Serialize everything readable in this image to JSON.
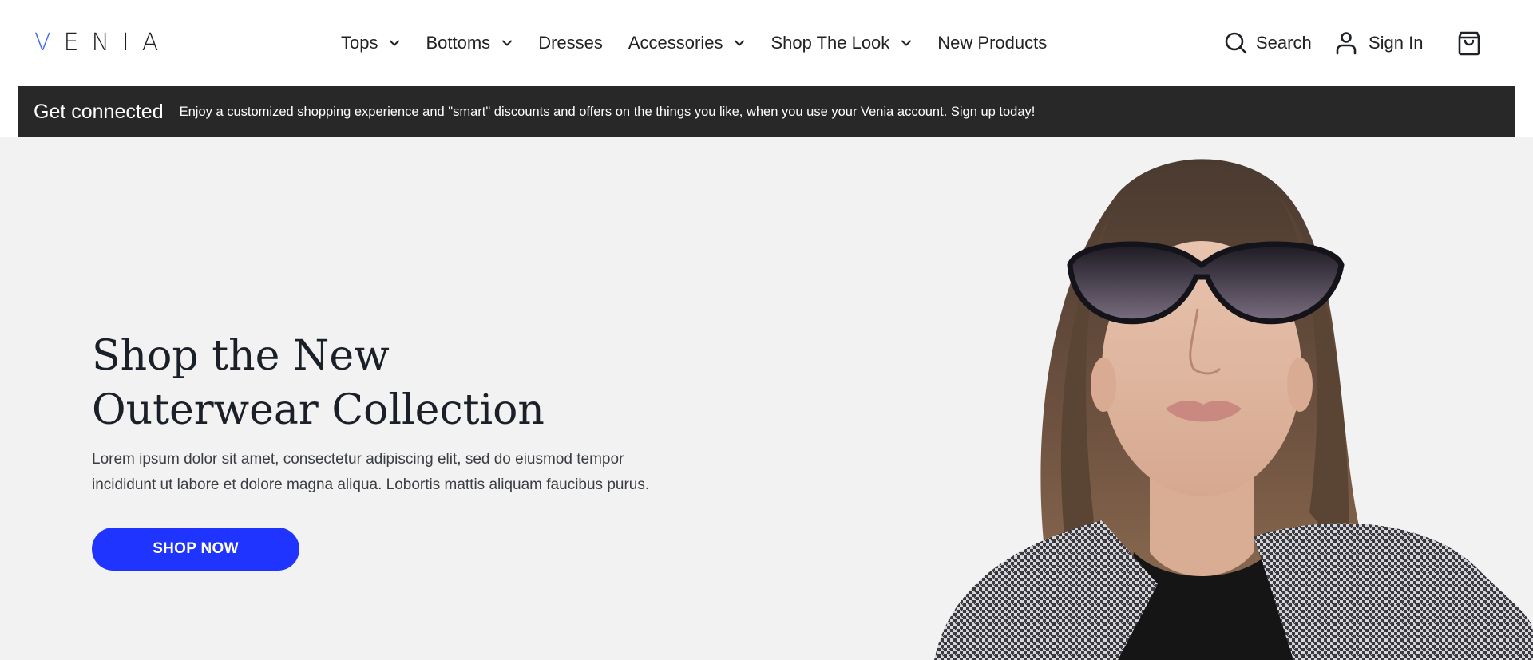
{
  "header": {
    "logo_first": "V",
    "logo_rest": "ENIA",
    "nav": [
      {
        "label": "Tops",
        "has_dropdown": true
      },
      {
        "label": "Bottoms",
        "has_dropdown": true
      },
      {
        "label": "Dresses",
        "has_dropdown": false
      },
      {
        "label": "Accessories",
        "has_dropdown": true
      },
      {
        "label": "Shop The Look",
        "has_dropdown": true
      },
      {
        "label": "New Products",
        "has_dropdown": false
      }
    ],
    "search_label": "Search",
    "signin_label": "Sign In",
    "icons": {
      "search": "search-icon",
      "account": "user-icon",
      "cart": "shopping-bag-icon",
      "dropdown": "chevron-down-icon"
    }
  },
  "banner": {
    "title": "Get connected",
    "text": "Enjoy a customized shopping experience and \"smart\" discounts and offers on the things you like, when you use your Venia account. Sign up today!"
  },
  "hero": {
    "title_line1": "Shop the New",
    "title_line2": "Outerwear Collection",
    "desc_line1": "Lorem ipsum dolor sit amet, consectetur adipiscing elit, sed do eiusmod tempor",
    "desc_line2": "incididunt ut labore et dolore magna aliqua. Lobortis mattis aliquam faucibus purus.",
    "cta_label": "SHOP NOW",
    "image_alt": "Model wearing sunglasses and houndstooth coat"
  },
  "colors": {
    "brand_accent": "#3d6cf2",
    "cta": "#1f35ff",
    "banner_bg": "#282828",
    "hero_bg": "#f2f2f2"
  }
}
